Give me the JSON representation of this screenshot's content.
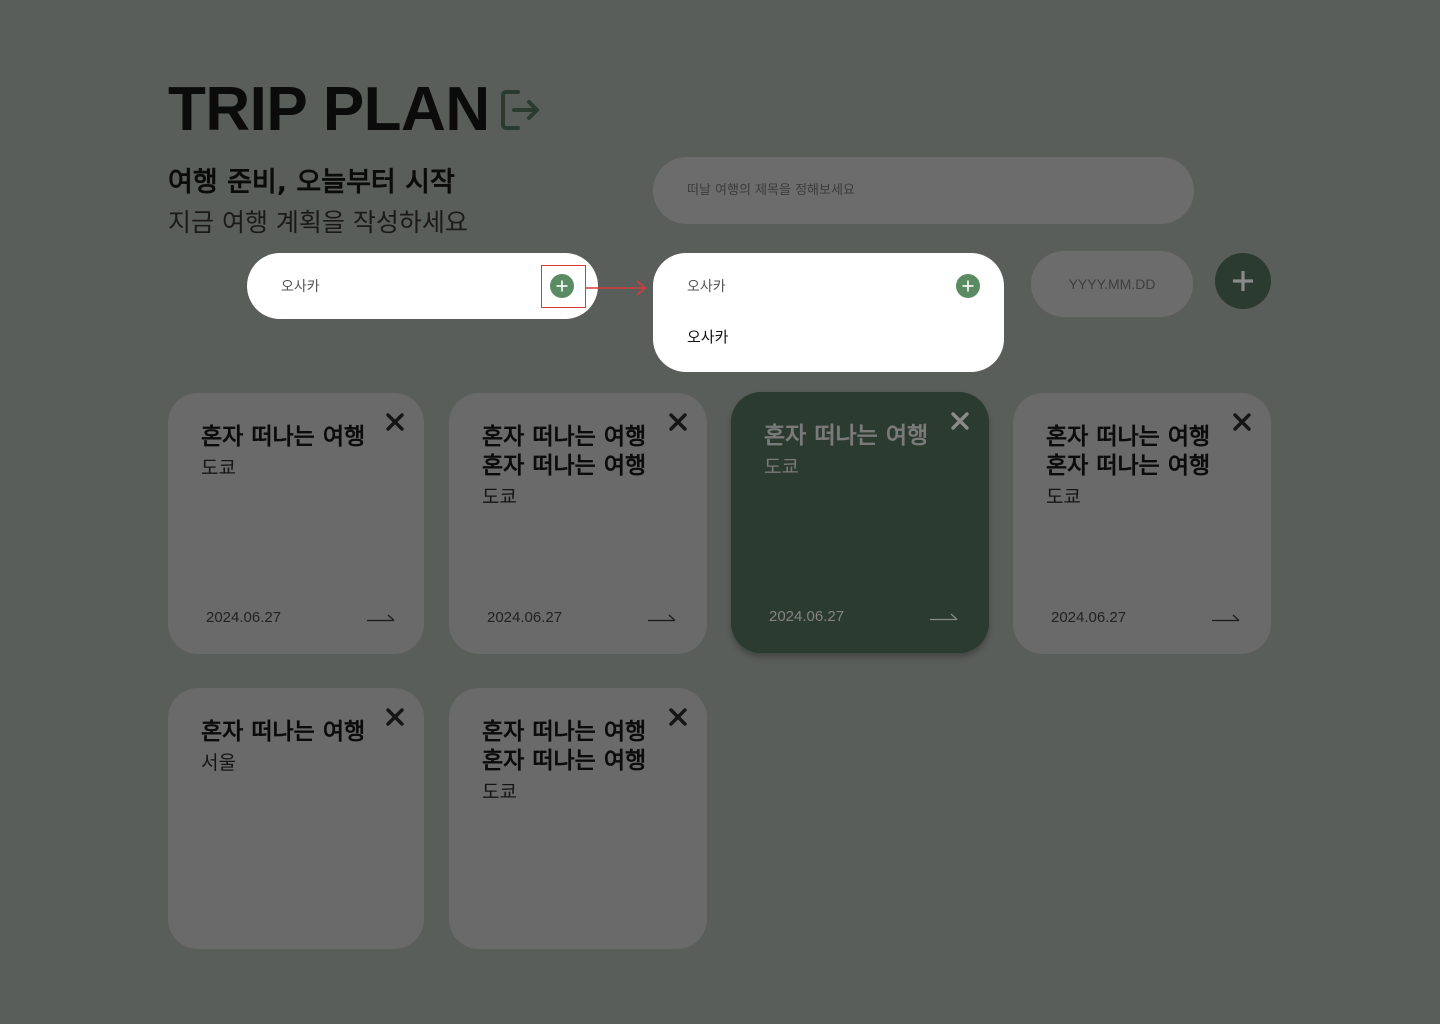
{
  "header": {
    "title": "TRIP PLAN",
    "subtitle": "여행 준비, 오늘부터 시작",
    "description": "지금 여행 계획을 작성하세요",
    "logout_icon": "logout-icon"
  },
  "form": {
    "trip_title_placeholder": "떠날 여행의 제목을 정해보세요",
    "city_value": "오사카",
    "dropdown_value": "오사카",
    "dropdown_option": "오사카",
    "date_placeholder": "YYYY.MM.DD",
    "add_icon": "plus-icon"
  },
  "colors": {
    "background": "#5a5e5a",
    "accent_dark": "#2c3b2f",
    "accent_green": "#5b8b62",
    "card": "#6a6a6a",
    "annotation_red": "#d63a3a"
  },
  "cards": [
    {
      "titles": [
        "혼자 떠나는 여행"
      ],
      "city": "도쿄",
      "date": "2024.06.27",
      "active": false
    },
    {
      "titles": [
        "혼자 떠나는 여행",
        "혼자 떠나는 여행"
      ],
      "city": "도쿄",
      "date": "2024.06.27",
      "active": false
    },
    {
      "titles": [
        "혼자 떠나는 여행"
      ],
      "city": "도쿄",
      "date": "2024.06.27",
      "active": true
    },
    {
      "titles": [
        "혼자 떠나는 여행",
        "혼자 떠나는 여행"
      ],
      "city": "도쿄",
      "date": "2024.06.27",
      "active": false
    },
    {
      "titles": [
        "혼자 떠나는 여행"
      ],
      "city": "서울",
      "date": "",
      "active": false
    },
    {
      "titles": [
        "혼자 떠나는 여행",
        "혼자 떠나는 여행"
      ],
      "city": "도쿄",
      "date": "",
      "active": false
    }
  ]
}
